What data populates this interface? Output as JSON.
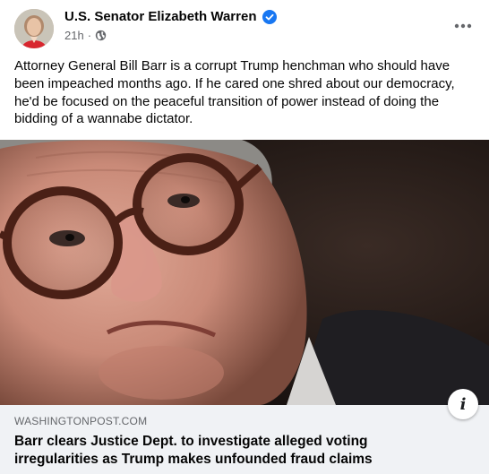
{
  "post": {
    "author": "U.S. Senator Elizabeth Warren",
    "timestamp": "21h",
    "separator": "·",
    "audience_icon": "globe-icon",
    "verified_icon": "verified-badge-icon",
    "more_icon": "more-options-icon",
    "text": "Attorney General Bill Barr is a corrupt Trump henchman who should have been impeached months ago. If he cared one shred about our democracy, he'd be focused on the peaceful transition of power instead of doing the bidding of a wannabe dictator."
  },
  "link_preview": {
    "domain": "WASHINGTONPOST.COM",
    "headline": "Barr clears Justice Dept. to investigate alleged voting irregularities as Trump makes unfounded fraud claims",
    "info_label": "i"
  },
  "colors": {
    "verified": "#1877f2",
    "secondary_text": "#65676b",
    "link_bg": "#f0f2f5"
  }
}
